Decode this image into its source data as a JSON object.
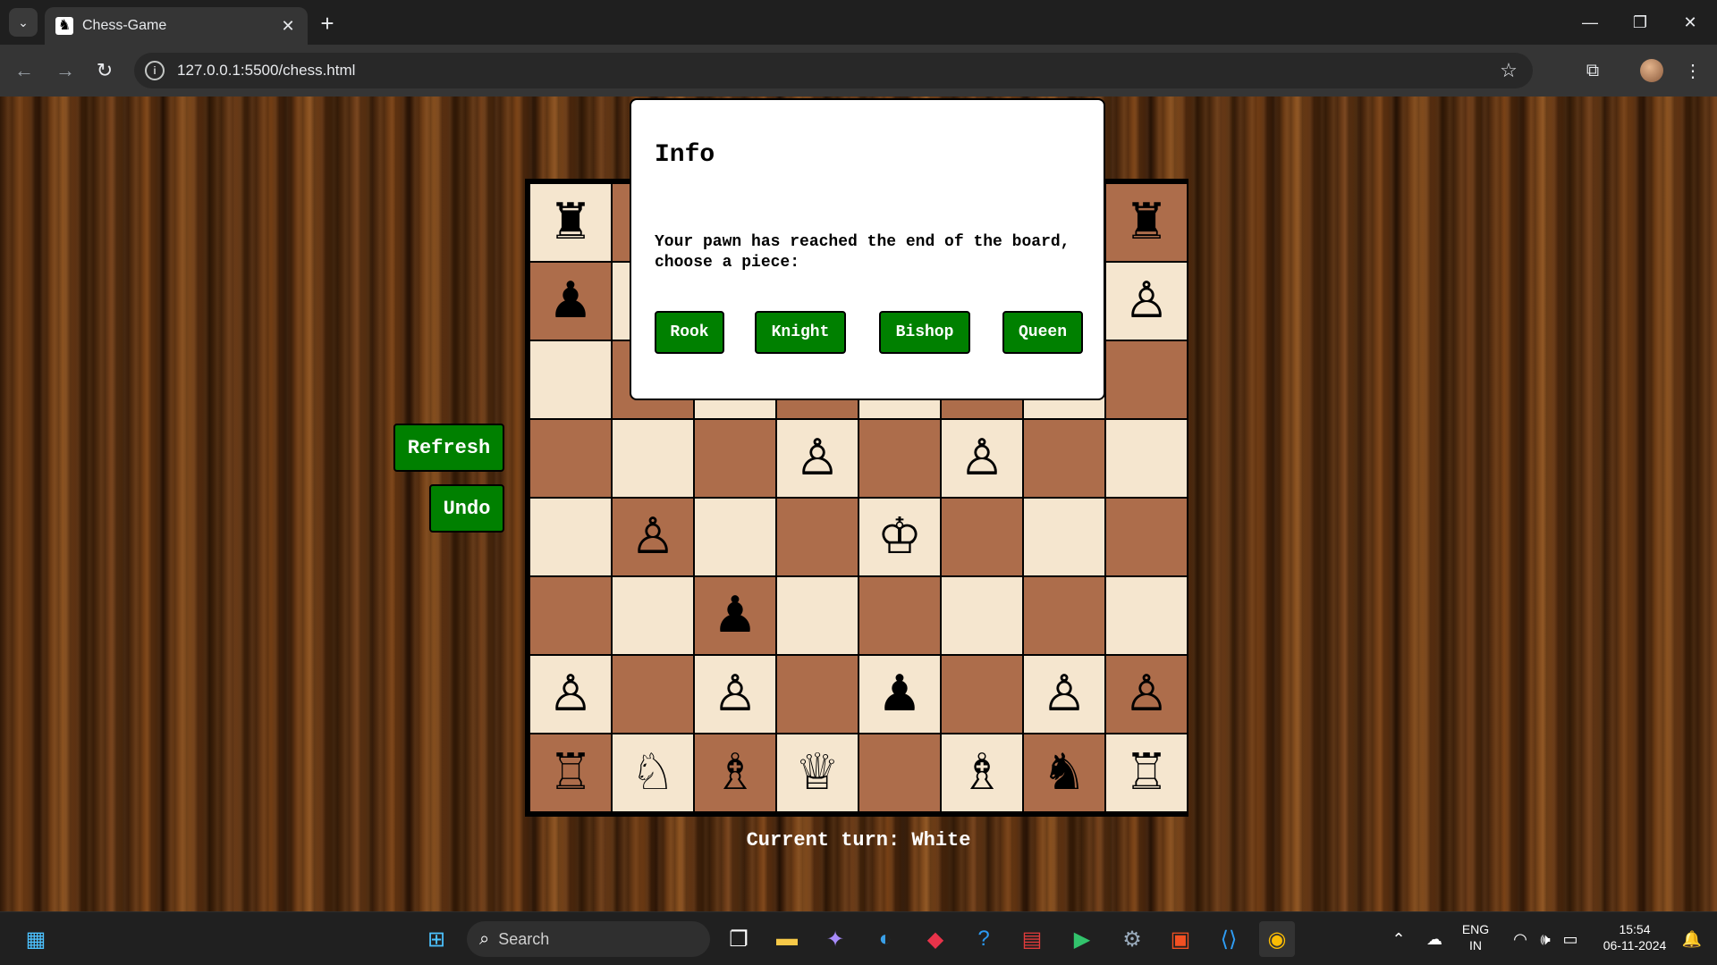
{
  "browser": {
    "tab_title": "Chess-Game",
    "url": "127.0.0.1:5500/chess.html"
  },
  "game": {
    "refresh_label": "Refresh",
    "undo_label": "Undo",
    "turn_text": "Current turn: White",
    "board": [
      [
        "♜",
        "",
        "",
        "",
        "",
        "",
        "",
        "♜"
      ],
      [
        "♟",
        "",
        "",
        "",
        "",
        "",
        "",
        "♙"
      ],
      [
        "",
        "",
        "",
        "",
        "",
        "",
        "",
        ""
      ],
      [
        "",
        "",
        "",
        "♙",
        "",
        "♙",
        "",
        ""
      ],
      [
        "",
        "♙",
        "",
        "",
        "♔",
        "",
        "",
        ""
      ],
      [
        "",
        "",
        "♟",
        "",
        "",
        "",
        "",
        ""
      ],
      [
        "♙",
        "",
        "♙",
        "",
        "♟",
        "",
        "♙",
        "♙"
      ],
      [
        "♖",
        "♘",
        "♗",
        "♕",
        "",
        "♗",
        "♞",
        "♖"
      ]
    ],
    "colors": {
      "light_square": "#f5e6cf",
      "dark_square": "#ad6d4b",
      "button_green": "#008000"
    }
  },
  "modal": {
    "title": "Info",
    "message": "Your pawn has reached the end of the board, choose a piece:",
    "options": [
      "Rook",
      "Knight",
      "Bishop",
      "Queen"
    ]
  },
  "taskbar": {
    "search_label": "Search",
    "language": "ENG",
    "region": "IN",
    "time": "15:54",
    "date": "06-11-2024"
  }
}
